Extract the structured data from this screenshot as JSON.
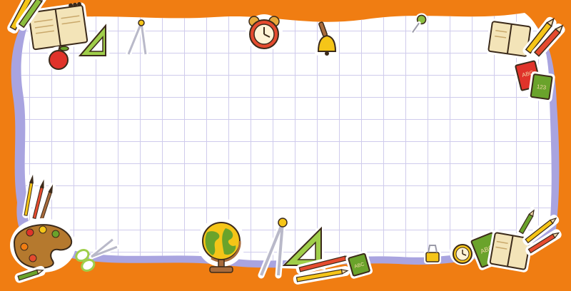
{
  "scene": {
    "background_color": "#f07d12",
    "shadow_color": "#a9a4e0",
    "paper_color": "#ffffff",
    "grid_color": "#cfcbec",
    "outline_color": "#3b2a1a",
    "sticker_border_color": "#ffffff",
    "icons": [
      "notebook-icon",
      "pencil-icon",
      "apple-icon",
      "set-square-icon",
      "compass-icon",
      "alarm-clock-icon",
      "school-bell-icon",
      "push-pin-icon",
      "books-icon",
      "paint-palette-icon",
      "paintbrush-icon",
      "scissors-icon",
      "globe-icon",
      "ruler-icon",
      "binder-clip-icon"
    ]
  },
  "book_labels": {
    "top_right_red": "ABC",
    "top_right_green": "123",
    "bottom_center_green": "ABC",
    "bottom_right_green": "ABC"
  }
}
